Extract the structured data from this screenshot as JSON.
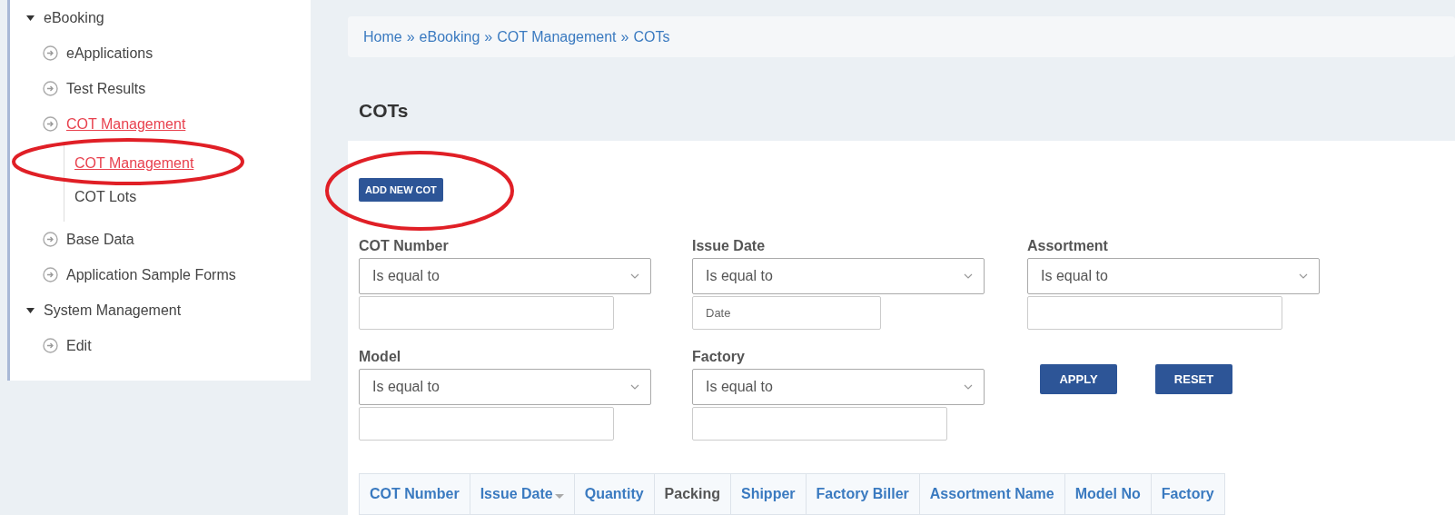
{
  "sidebar": {
    "items": [
      {
        "label": "eBooking",
        "expanded": true,
        "children": [
          {
            "label": "eApplications",
            "active": false
          },
          {
            "label": "Test Results",
            "active": false
          },
          {
            "label": "COT Management",
            "active": true,
            "children": [
              {
                "label": "COT Management",
                "selected": true
              },
              {
                "label": "COT Lots",
                "selected": false
              }
            ]
          },
          {
            "label": "Base Data",
            "active": false
          },
          {
            "label": "Application Sample Forms",
            "active": false
          }
        ]
      },
      {
        "label": "System Management",
        "expanded": true,
        "children": [
          {
            "label": "Edit",
            "active": false
          }
        ]
      }
    ]
  },
  "breadcrumb": [
    "Home",
    "»",
    "eBooking",
    "»",
    "COT Management",
    "»",
    "COTs"
  ],
  "page_title": "COTs",
  "add_button": "ADD NEW COT",
  "filters": [
    {
      "label": "COT Number",
      "operator": "Is equal to"
    },
    {
      "label": "Issue Date",
      "operator": "Is equal to",
      "placeholder": "Date"
    },
    {
      "label": "Assortment",
      "operator": "Is equal to"
    },
    {
      "label": "Model",
      "operator": "Is equal to"
    },
    {
      "label": "Factory",
      "operator": "Is equal to"
    }
  ],
  "filter_buttons": [
    "APPLY",
    "RESET"
  ],
  "table": {
    "columns": [
      {
        "label": "COT Number",
        "sortable": true,
        "sorted": false
      },
      {
        "label": "Issue Date",
        "sortable": true,
        "sorted": true
      },
      {
        "label": "Quantity",
        "sortable": true,
        "sorted": false
      },
      {
        "label": "Packing",
        "sortable": false,
        "sorted": false
      },
      {
        "label": "Shipper",
        "sortable": true,
        "sorted": false
      },
      {
        "label": "Factory Biller",
        "sortable": true,
        "sorted": false
      },
      {
        "label": "Assortment Name",
        "sortable": true,
        "sorted": false
      },
      {
        "label": "Model No",
        "sortable": true,
        "sorted": false
      },
      {
        "label": "Factory",
        "sortable": true,
        "sorted": false
      }
    ]
  },
  "annotations": [
    {
      "kind": "ellipse"
    },
    {
      "kind": "ellipse"
    }
  ]
}
